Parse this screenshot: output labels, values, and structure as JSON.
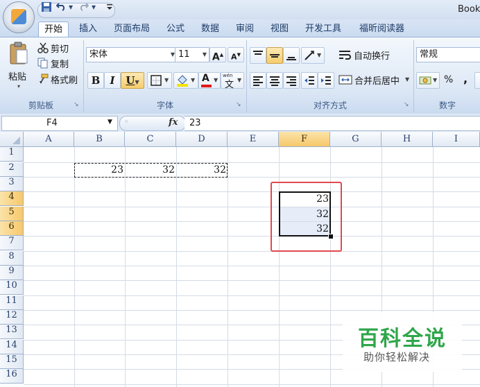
{
  "window": {
    "title": "Book"
  },
  "qat": {
    "dropdown": "▾"
  },
  "tabs": [
    "开始",
    "插入",
    "页面布局",
    "公式",
    "数据",
    "审阅",
    "视图",
    "开发工具",
    "福昕阅读器"
  ],
  "ribbon": {
    "clipboard": {
      "paste": "粘贴",
      "cut": "剪切",
      "copy": "复制",
      "format_painter": "格式刷",
      "label": "剪贴板"
    },
    "font": {
      "name": "宋体",
      "size": "11",
      "grow": "A",
      "shrink": "A",
      "bold": "B",
      "italic": "I",
      "underline": "U",
      "font_color_glyph": "A",
      "phonetic": "wén",
      "label": "字体"
    },
    "alignment": {
      "wrap_text": "自动换行",
      "merge_center": "合并后居中",
      "label": "对齐方式"
    },
    "number": {
      "format": "常规",
      "percent": "%",
      "comma": ",",
      "label": "数字"
    }
  },
  "formula_bar": {
    "name_box": "F4",
    "fx": "fx",
    "formula": "23"
  },
  "columns": [
    "A",
    "B",
    "C",
    "D",
    "E",
    "F",
    "G",
    "H",
    "I"
  ],
  "rows": [
    "1",
    "2",
    "3",
    "4",
    "5",
    "6",
    "7",
    "8",
    "9",
    "10",
    "11",
    "12",
    "13",
    "14",
    "15",
    "16"
  ],
  "cells": {
    "B2": "23",
    "C2": "32",
    "D2": "32",
    "F4": "23",
    "F5": "32",
    "F6": "32"
  },
  "watermark": {
    "title": "百科全说",
    "subtitle": "助你轻松解决"
  },
  "colors": {
    "accent_red": "#e0494f",
    "header_active": "#f6c86b",
    "watermark_green": "#2fa64a"
  }
}
